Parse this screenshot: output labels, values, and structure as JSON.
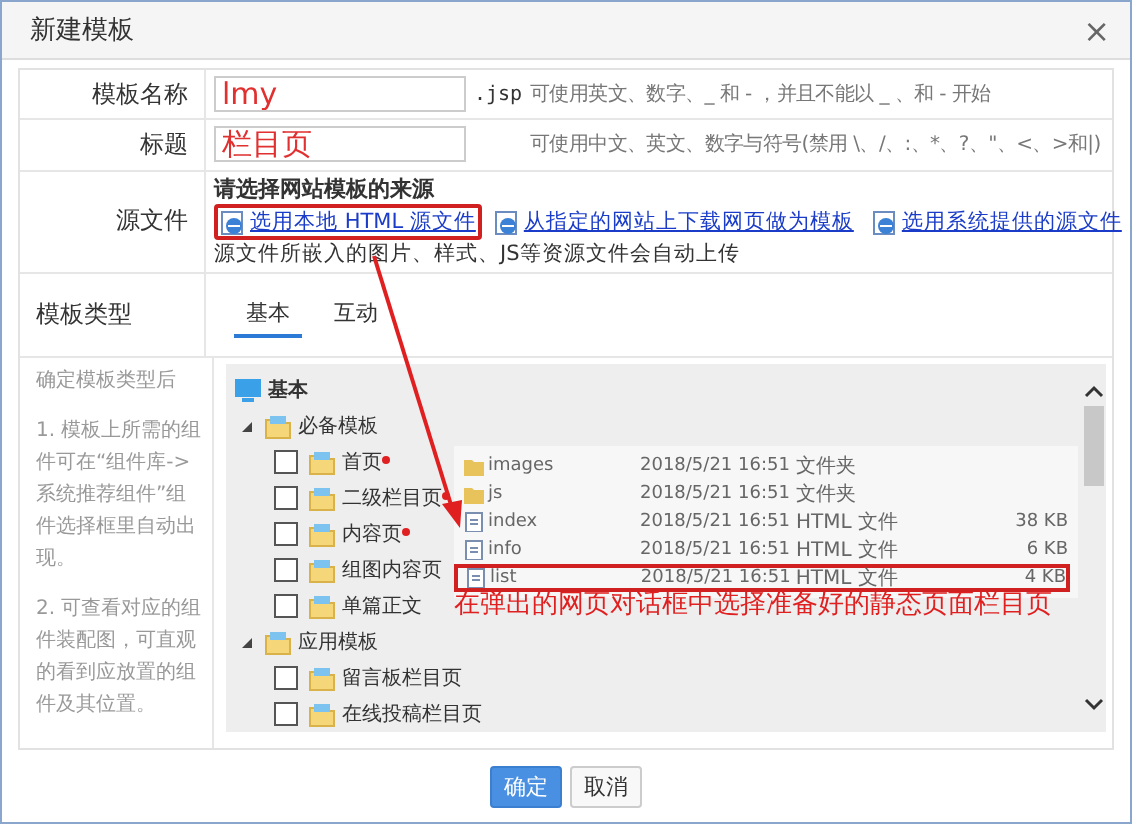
{
  "window": {
    "title": "新建模板",
    "close": "×"
  },
  "fields": [
    {
      "label": "模板名称",
      "value": "lmy",
      "suffix": ".jsp",
      "hint": "可使用英文、数字、_ 和 - ，并且不能以 _ 、和 - 开始"
    },
    {
      "label": "标题",
      "value": "栏目页",
      "hint": "可使用中文、英文、数字与符号(禁用 \\、/、:、*、?、\"、<、>和|)"
    }
  ],
  "source": {
    "label": "源文件",
    "heading": "请选择网站模板的来源",
    "links": [
      {
        "text": "选用本地 HTML 源文件",
        "highlighted": true
      },
      {
        "text": "从指定的网站上下载网页做为模板",
        "highlighted": false
      },
      {
        "text": "选用系统提供的源文件",
        "highlighted": false
      }
    ],
    "note": "源文件所嵌入的图片、样式、JS等资源文件会自动上传"
  },
  "template_type": {
    "label": "模板类型",
    "tabs": [
      {
        "label": "基本",
        "selected": true
      },
      {
        "label": "互动",
        "selected": false
      }
    ]
  },
  "help": [
    "确定模板类型后",
    "1. 模板上所需的组件可在“组件库->系统推荐组件”组件选择框里自动出现。",
    "2. 可查看对应的组件装配图，可直观的看到应放置的组件及其位置。"
  ],
  "tree": {
    "root": "基本",
    "groups": [
      {
        "label": "必备模板",
        "expanded": true,
        "children": [
          {
            "label": "首页",
            "checked": false,
            "required": true
          },
          {
            "label": "二级栏目页",
            "checked": false,
            "required": true
          },
          {
            "label": "内容页",
            "checked": false,
            "required": true
          },
          {
            "label": "组图内容页",
            "checked": false,
            "required": false
          },
          {
            "label": "单篇正文",
            "checked": false,
            "required": false
          }
        ]
      },
      {
        "label": "应用模板",
        "expanded": true,
        "children": [
          {
            "label": "留言板栏目页",
            "checked": false,
            "required": false
          },
          {
            "label": "在线投稿栏目页",
            "checked": false,
            "required": false
          }
        ]
      }
    ]
  },
  "file_list": [
    {
      "kind": "folder",
      "name": "images",
      "modified": "2018/5/21 16:51",
      "type": "文件夹",
      "highlighted": false
    },
    {
      "kind": "folder",
      "name": "js",
      "modified": "2018/5/21 16:51",
      "type": "文件夹",
      "highlighted": false
    },
    {
      "kind": "file",
      "name": "index",
      "modified": "2018/5/21 16:51",
      "type": "HTML 文件",
      "size": "38 KB",
      "highlighted": false
    },
    {
      "kind": "file",
      "name": "info",
      "modified": "2018/5/21 16:51",
      "type": "HTML 文件",
      "size": "6 KB",
      "highlighted": false
    },
    {
      "kind": "file",
      "name": "list",
      "modified": "2018/5/21 16:51",
      "type": "HTML 文件",
      "size": "4 KB",
      "highlighted": true
    }
  ],
  "annotation": "在弹出的网页对话框中选择准备好的静态页面栏目页",
  "buttons": [
    {
      "label": "确定",
      "kind": "primary"
    },
    {
      "label": "取消",
      "kind": "default"
    }
  ]
}
